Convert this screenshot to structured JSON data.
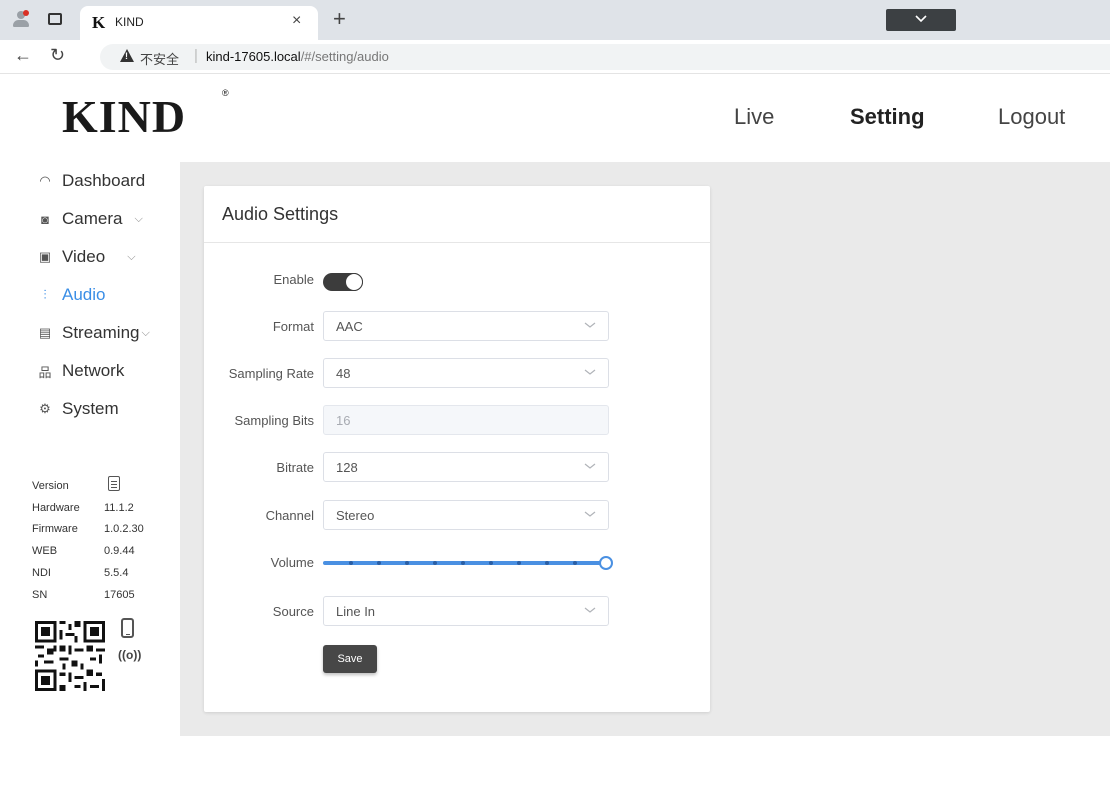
{
  "browser": {
    "tab_title": "KIND",
    "tab_favicon": "K",
    "tab_close": "×",
    "tab_new": "+",
    "security_label": "不安全",
    "url_host": "kind-17605.local",
    "url_path": "/#/setting/audio"
  },
  "header": {
    "logo": "KIND",
    "logo_mark": "®",
    "nav": {
      "live": "Live",
      "setting": "Setting",
      "logout": "Logout"
    }
  },
  "sidebar": {
    "items": [
      {
        "label": "Dashboard",
        "icon": "dashboard-icon"
      },
      {
        "label": "Camera",
        "icon": "camera-icon"
      },
      {
        "label": "Video",
        "icon": "video-icon"
      },
      {
        "label": "Audio",
        "icon": "audio-icon",
        "active": true
      },
      {
        "label": "Streaming",
        "icon": "streaming-icon"
      },
      {
        "label": "Network",
        "icon": "network-icon"
      },
      {
        "label": "System",
        "icon": "system-icon"
      }
    ],
    "active_color": "#3a8ee6",
    "info": {
      "version_label": "Version",
      "hardware_label": "Hardware",
      "hardware": "11.1.2",
      "firmware_label": "Firmware",
      "firmware": "1.0.2.30",
      "web_label": "WEB",
      "web": "0.9.44",
      "ndi_label": "NDI",
      "ndi": "5.5.4",
      "sn_label": "SN",
      "sn": "17605"
    }
  },
  "audio": {
    "title": "Audio Settings",
    "enable_label": "Enable",
    "enabled": true,
    "format_label": "Format",
    "format": "AAC",
    "sampling_rate_label": "Sampling Rate",
    "sampling_rate": "48",
    "sampling_bits_label": "Sampling Bits",
    "sampling_bits": "16",
    "bitrate_label": "Bitrate",
    "bitrate": "128",
    "channel_label": "Channel",
    "channel": "Stereo",
    "volume_label": "Volume",
    "volume": 1.0,
    "source_label": "Source",
    "source": "Line In",
    "save_label": "Save"
  }
}
